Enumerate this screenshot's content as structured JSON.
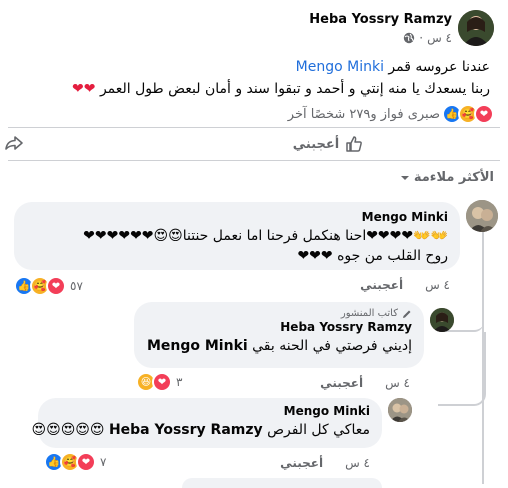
{
  "post": {
    "author": "Heba Yossry Ramzy",
    "time": "٤ س",
    "dot": "·",
    "line1_prefix": "عندنا عروسه قمر",
    "line1_mention": "Mengo Minki",
    "line2": "ربنا يسعدك يا منه إنتي و أحمد و تبقوا سند و أمان لبعض طول العمر",
    "line2_hearts": "❤❤",
    "reactions_summary": "صبرى فواز و٢٧٩ شخصًا آخر",
    "like_label": "أعجبني"
  },
  "sort": {
    "label": "الأكثر ملاءمة"
  },
  "comments": [
    {
      "author": "Mengo Minki",
      "line1": "👐👐❤❤❤❤احنا هنكمل فرحنا اما نعمل حنتنا😍😍❤❤❤❤❤❤",
      "line2": "روح القلب من جوه ❤❤❤",
      "time": "٤ س",
      "like_label": "أعجبني",
      "react_count": "٥٧"
    },
    {
      "badge": "كاتب المنشور",
      "author": "Heba Yossry Ramzy",
      "line1_prefix": "إديني فرصتي في الحنه بقي",
      "line1_mention": "Mengo Minki",
      "time": "٤ س",
      "like_label": "أعجبني",
      "react_count": "٣"
    },
    {
      "author": "Mengo Minki",
      "line1_emojis": "😍😍😍😍😍",
      "line1_text": "معاكي كل الفرص",
      "line1_mention": "Heba Yossry Ramzy",
      "time": "٤ س",
      "like_label": "أعجبني",
      "react_count": "٧"
    }
  ]
}
